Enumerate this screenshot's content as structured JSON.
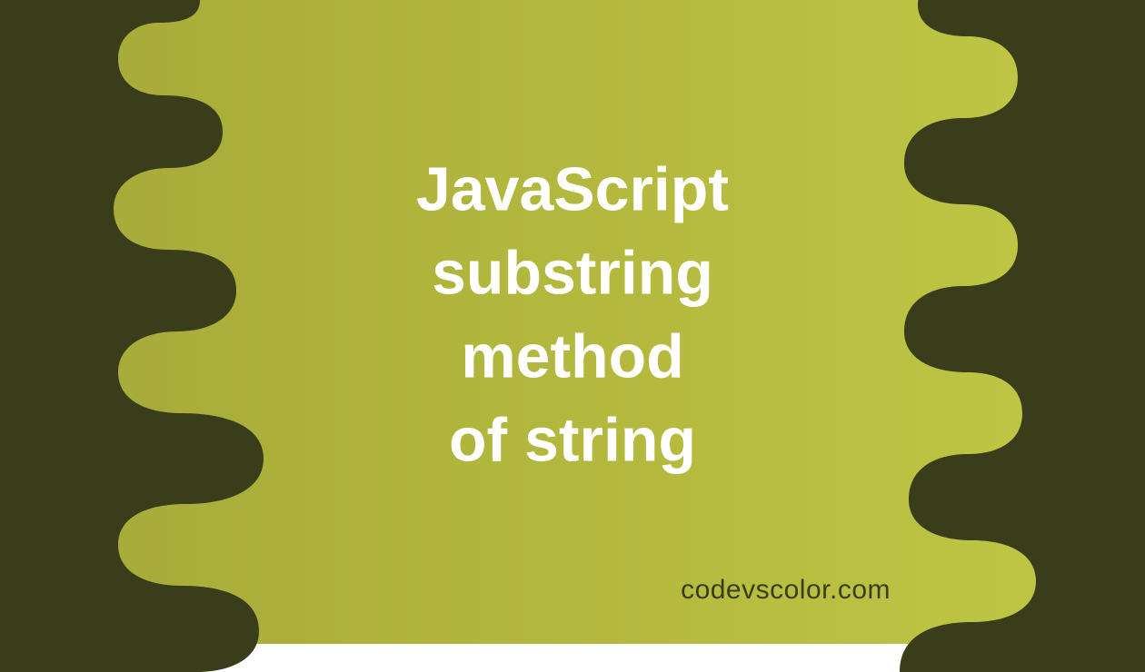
{
  "title": "JavaScript\nsubstring\nmethod\nof string",
  "watermark": "codevscolor.com",
  "colors": {
    "bg_gradient_start": "#a5a838",
    "bg_gradient_end": "#c1c845",
    "blob": "#3a3d1a",
    "title_text": "#ffffff",
    "watermark_text": "#3a3d1a"
  }
}
